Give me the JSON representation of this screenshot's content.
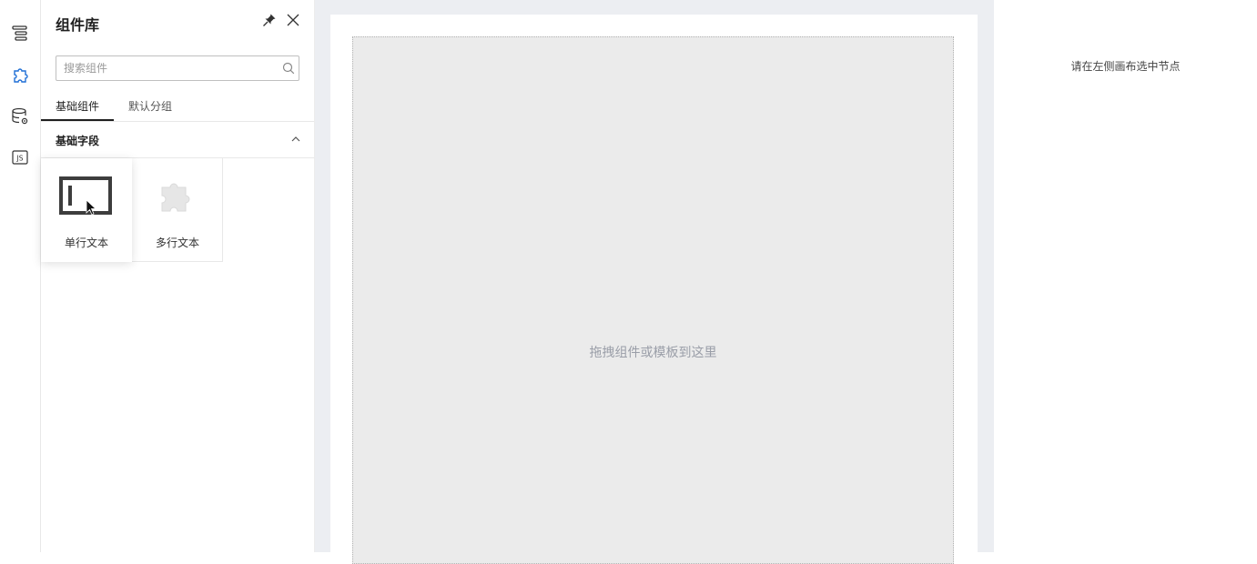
{
  "rail": {
    "items": [
      {
        "icon": "outline-tree-icon",
        "active": false
      },
      {
        "icon": "puzzle-component-icon",
        "active": true
      },
      {
        "icon": "datasource-icon",
        "active": false
      },
      {
        "icon": "js-code-icon",
        "label": "JS",
        "active": false
      }
    ]
  },
  "panel": {
    "title": "组件库",
    "search": {
      "placeholder": "搜索组件",
      "value": ""
    },
    "tabs": [
      {
        "label": "基础组件",
        "active": true
      },
      {
        "label": "默认分组",
        "active": false
      }
    ],
    "group": {
      "title": "基础字段",
      "expanded": true
    },
    "components": [
      {
        "label": "单行文本",
        "icon": "single-line-text-icon"
      },
      {
        "label": "多行文本",
        "icon": "puzzle-placeholder-icon"
      }
    ]
  },
  "canvas": {
    "hint": "拖拽组件或模板到这里"
  },
  "settings": {
    "hint": "请在左侧画布选中节点"
  },
  "colors": {
    "accent": "#1f6fd6",
    "canvas_bg": "#eceef2",
    "dropzone_bg": "#ebebeb"
  }
}
